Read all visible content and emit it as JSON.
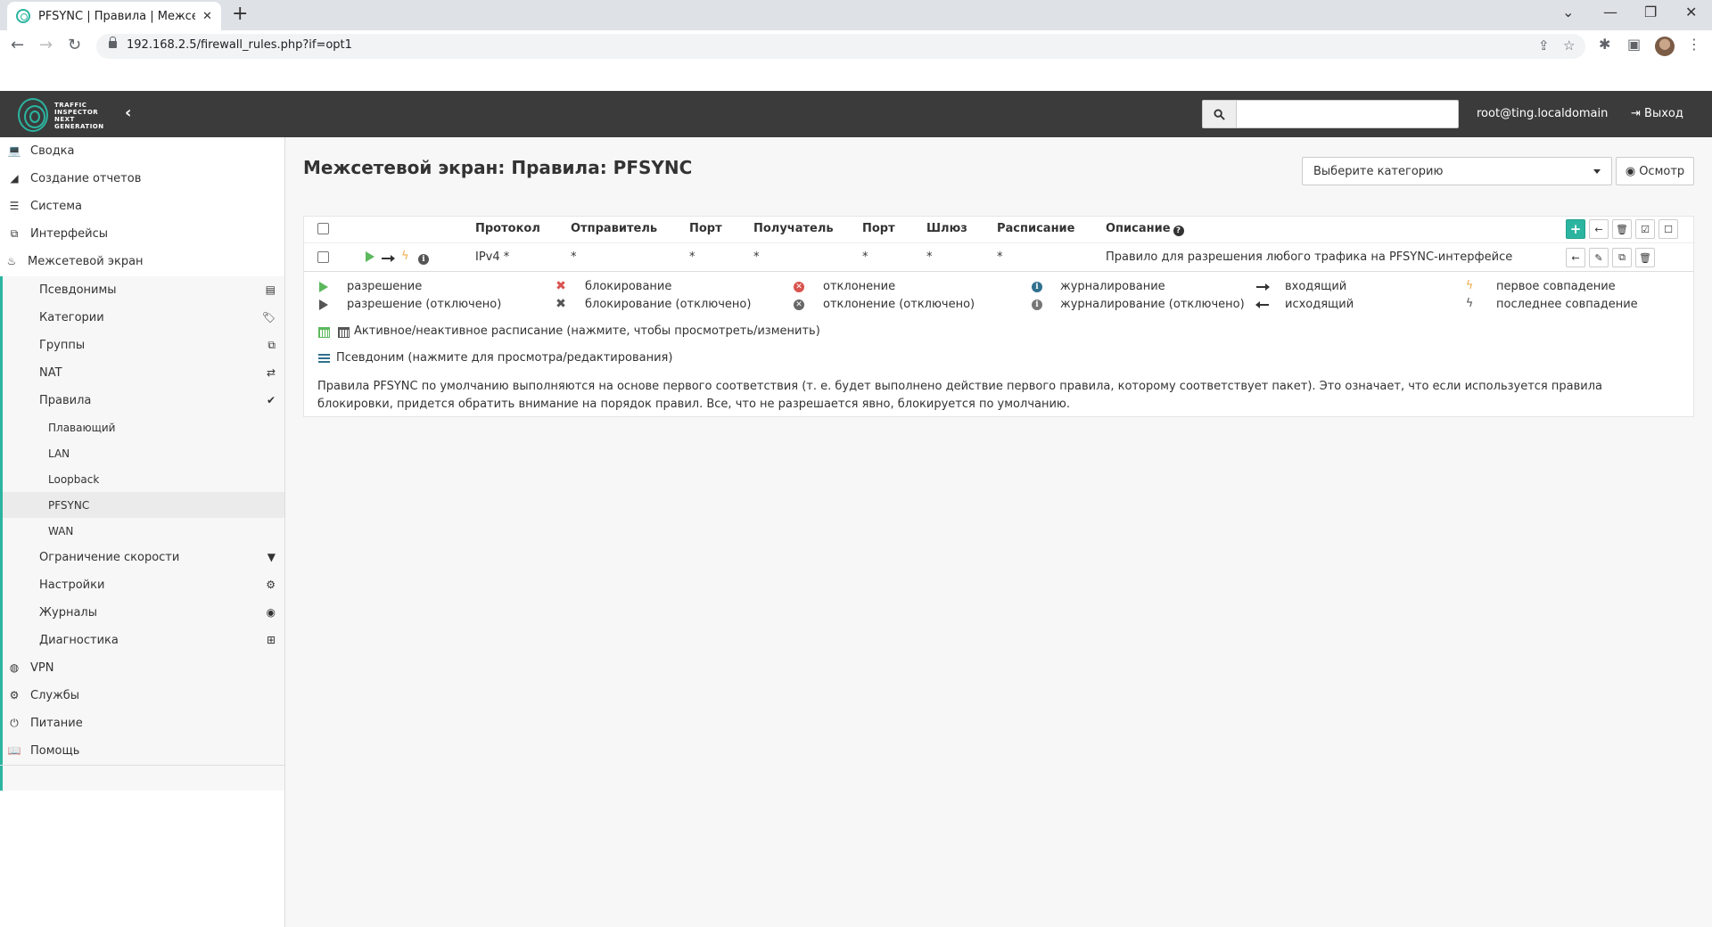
{
  "browser": {
    "tab_title": "PFSYNC | Правила | Межсетевой экран",
    "url": "192.168.2.5/firewall_rules.php?if=opt1"
  },
  "header": {
    "logo_lines": [
      "TRAFFIC",
      "INSPECTOR",
      "NEXT",
      "GENERATION"
    ],
    "search_placeholder": "",
    "user": "root@ting.localdomain",
    "logout_label": "Выход"
  },
  "sidebar": {
    "top_items": [
      {
        "label": "Сводка",
        "icon": "laptop-icon"
      },
      {
        "label": "Создание отчетов",
        "icon": "area-chart-icon"
      },
      {
        "label": "Система",
        "icon": "server-icon"
      },
      {
        "label": "Интерфейсы",
        "icon": "sitemap-icon"
      },
      {
        "label": "Межсетевой экран",
        "icon": "fire-icon"
      }
    ],
    "firewall_items": [
      {
        "label": "Псевдонимы",
        "icon": "list-alt-icon"
      },
      {
        "label": "Категории",
        "icon": "tags-icon"
      },
      {
        "label": "Группы",
        "icon": "sitemap-icon"
      },
      {
        "label": "NAT",
        "icon": "exchange-icon"
      },
      {
        "label": "Правила",
        "icon": "check-icon"
      }
    ],
    "rules_items": [
      "Плавающий",
      "LAN",
      "Loopback",
      "PFSYNC",
      "WAN"
    ],
    "firewall_items_after": [
      {
        "label": "Ограничение скорости",
        "icon": "filter-icon"
      },
      {
        "label": "Настройки",
        "icon": "cogs-icon"
      },
      {
        "label": "Журналы",
        "icon": "eye-icon"
      },
      {
        "label": "Диагностика",
        "icon": "medkit-icon"
      }
    ],
    "bottom_items": [
      {
        "label": "VPN",
        "icon": "globe-icon"
      },
      {
        "label": "Службы",
        "icon": "cog-icon"
      },
      {
        "label": "Питание",
        "icon": "plug-icon"
      },
      {
        "label": "Помощь",
        "icon": "book-icon"
      }
    ]
  },
  "main": {
    "title": "Межсетевой экран: Правила: PFSYNC",
    "category_select": "Выберите категорию",
    "inspect_label": "Осмотр",
    "table": {
      "headers": {
        "protocol": "Протокол",
        "source": "Отправитель",
        "source_port": "Порт",
        "destination": "Получатель",
        "dest_port": "Порт",
        "gateway": "Шлюз",
        "schedule": "Расписание",
        "description": "Описание"
      },
      "row": {
        "protocol": "IPv4 *",
        "source": "*",
        "source_port": "*",
        "destination": "*",
        "dest_port": "*",
        "gateway": "*",
        "schedule": "*",
        "description": "Правило для разрешения любого трафика на PFSYNC-интерфейсе"
      }
    },
    "legend": {
      "pass": "разрешение",
      "pass_disabled": "разрешение (отключено)",
      "block": "блокирование",
      "block_disabled": "блокирование (отключено)",
      "reject": "отклонение",
      "reject_disabled": "отклонение (отключено)",
      "log": "журналирование",
      "log_disabled": "журналирование (отключено)",
      "in": "входящий",
      "out": "исходящий",
      "first_match": "первое совпадение",
      "last_match": "последнее совпадение",
      "schedule": "Активное/неактивное расписание (нажмите, чтобы просмотреть/изменить)",
      "alias": "Псевдоним (нажмите для просмотра/редактирования)"
    },
    "info_text": "Правила PFSYNC по умолчанию выполняются на основе первого соответствия (т. е. будет выполнено действие первого правила, которому соответствует пакет). Это означает, что если используется правила блокировки, придется обратить внимание на порядок правил. Все, что не разрешается явно, блокируется по умолчанию."
  },
  "colors": {
    "accent": "#2bb5a0",
    "header_bg": "#3b3b3b",
    "pass": "#5cb85c",
    "block": "#d9534f",
    "log": "#31708f",
    "first_match": "#f0ad4e"
  }
}
